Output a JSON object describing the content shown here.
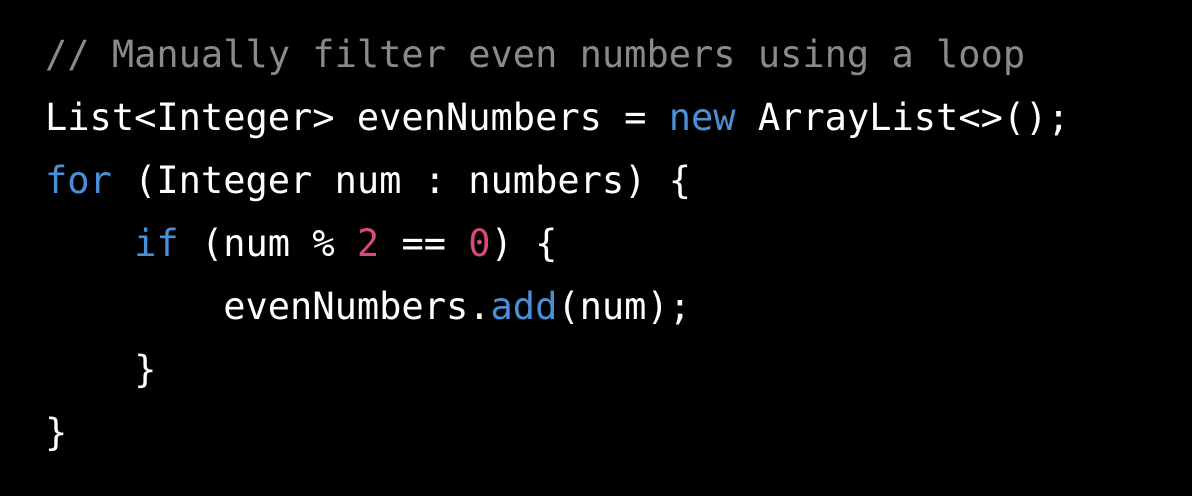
{
  "theme": {
    "background": "#000000",
    "text": "#ffffff",
    "comment": "#8a8a8a",
    "keyword": "#4a90d9",
    "number": "#d94a7a"
  },
  "code": {
    "line1": {
      "comment": "// Manually filter even numbers using a loop"
    },
    "line2": {
      "decl": "List<Integer> evenNumbers = ",
      "kw_new": "new",
      "ctor": " ArrayList<>();"
    },
    "line3": {
      "kw_for": "for",
      "rest": " (Integer num : numbers) {"
    },
    "line4": {
      "indent": "    ",
      "kw_if": "if",
      "cond_a": " (num % ",
      "num_two": "2",
      "cond_b": " == ",
      "num_zero": "0",
      "cond_c": ") {"
    },
    "line5": {
      "indent": "        ",
      "target": "evenNumbers.",
      "method": "add",
      "args": "(num);"
    },
    "line6": {
      "indent": "    ",
      "brace": "}"
    },
    "line7": {
      "brace": "}"
    }
  }
}
